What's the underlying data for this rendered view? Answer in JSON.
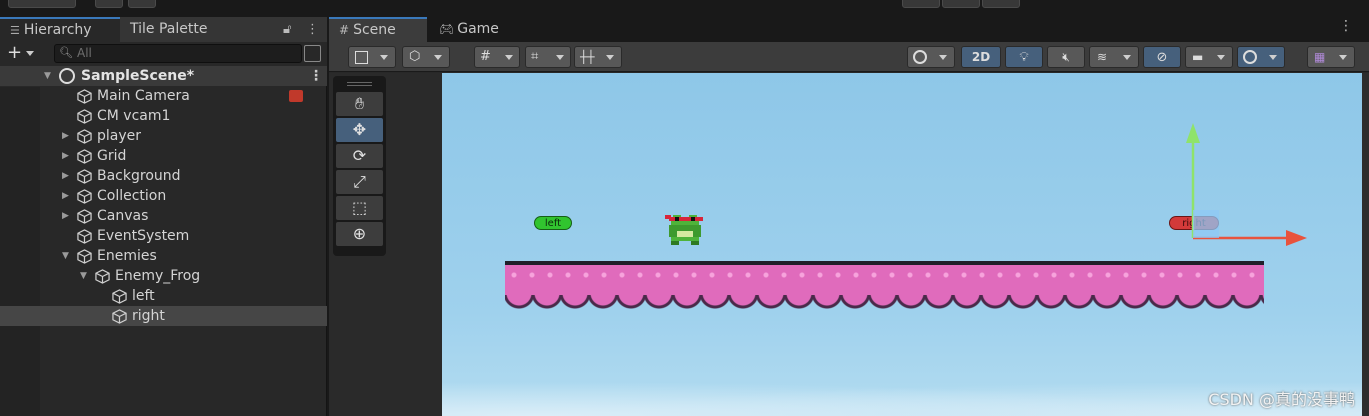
{
  "hierarchy": {
    "tab_label": "Hierarchy",
    "other_tab_label": "Tile Palette",
    "search_placeholder": "All",
    "scene_name": "SampleScene*",
    "items": [
      {
        "label": "Main Camera"
      },
      {
        "label": "CM vcam1"
      },
      {
        "label": "player"
      },
      {
        "label": "Grid"
      },
      {
        "label": "Background"
      },
      {
        "label": "Collection"
      },
      {
        "label": "Canvas"
      },
      {
        "label": "EventSystem"
      },
      {
        "label": "Enemies"
      },
      {
        "label": "Enemy_Frog"
      },
      {
        "label": "left"
      },
      {
        "label": "right"
      }
    ]
  },
  "scene": {
    "tab_label": "Scene",
    "game_tab_label": "Game",
    "mode_2d_label": "2D",
    "markers": {
      "left": "left",
      "right": "right"
    }
  },
  "watermark": "CSDN @真的没事鸭",
  "colors": {
    "accent": "#3a79bb",
    "selected_row": "#464646",
    "sky": "#9fd1ed",
    "ground_pink": "#e06bbc",
    "dirt": "#d8a172"
  }
}
